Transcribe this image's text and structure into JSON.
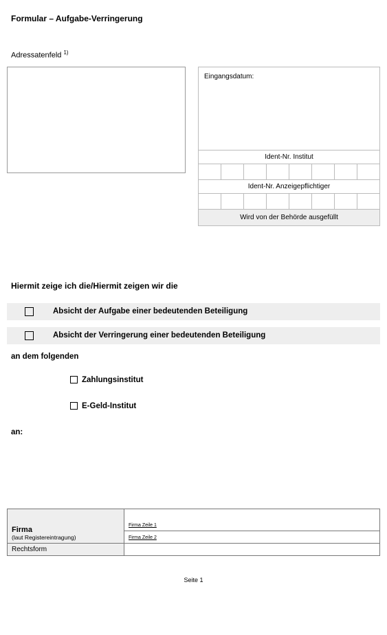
{
  "title": "Formular – Aufgabe-Verringerung",
  "addressLabel": "Adressatenfeld",
  "addressFootnote": "1)",
  "rightBox": {
    "eingangsdatum": "Eingangsdatum:",
    "identInstitut": "Ident-Nr. Institut",
    "identAnzeige": "Ident-Nr. Anzeigepflichtiger",
    "authNote": "Wird von der Behörde ausgefüllt"
  },
  "declaration": "Hiermit zeige ich die/Hiermit zeigen wir die",
  "option1": "Absicht der Aufgabe einer bedeutenden Beteiligung",
  "option2": "Absicht der Verringerung einer bedeutenden Beteiligung",
  "anDemFolgenden": "an dem folgenden",
  "instType1": "Zahlungsinstitut",
  "instType2": "E-Geld-Institut",
  "an": "an:",
  "table": {
    "firmaLabel": "Firma",
    "firmaSub": "(laut Registereintragung)",
    "firmaZeile1": "Firma Zeile 1",
    "firmaZeile2": "Firma Zeile 2",
    "rechtsform": "Rechtsform"
  },
  "footer": "Seite 1"
}
